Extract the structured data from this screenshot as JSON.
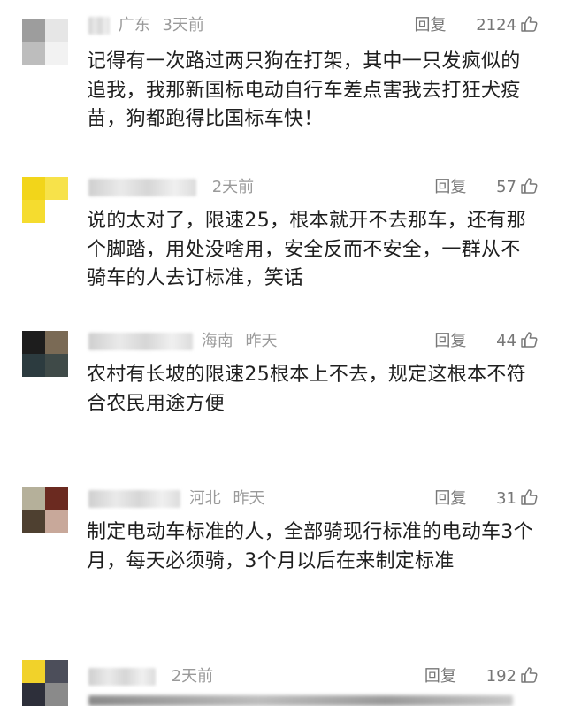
{
  "comments": [
    {
      "region": "广东",
      "time": "3天前",
      "reply_label": "回复",
      "likes": "2124",
      "text": "记得有一次路过两只狗在打架，其中一只发疯似的追我，我那新国标电动自行车差点害我去打狂犬疫苗，狗都跑得比国标车快！",
      "avatar_colors": [
        "#9d9d9d",
        "#e6e6e6",
        "#bdbdbd",
        "#f2f2f2"
      ]
    },
    {
      "region": "",
      "time": "2天前",
      "reply_label": "回复",
      "likes": "57",
      "text": "说的太对了，限速25，根本就开不去那车，还有那个脚踏，用处没啥用，安全反而不安全，一群从不骑车的人去订标准，笑话",
      "avatar_colors": [
        "#f2d51a",
        "#f7e24a",
        "#f5dc2f",
        "#ffffff"
      ]
    },
    {
      "region": "海南",
      "time": "昨天",
      "reply_label": "回复",
      "likes": "44",
      "text": "农村有长坡的限速25根本上不去，规定这根本不符合农民用途方便",
      "avatar_colors": [
        "#1d1d1d",
        "#7a6a55",
        "#2c3b3f",
        "#3f4a48"
      ]
    },
    {
      "region": "河北",
      "time": "昨天",
      "reply_label": "回复",
      "likes": "31",
      "text": "制定电动车标准的人，全部骑现行标准的电动车3个月，每天必须骑，3个月以后在来制定标准",
      "avatar_colors": [
        "#b5b09a",
        "#6b2a20",
        "#4e4030",
        "#c8a89a"
      ]
    },
    {
      "region": "",
      "time": "2天前",
      "reply_label": "回复",
      "likes": "192",
      "text": "",
      "avatar_colors": [
        "#f1d22a",
        "#4c4e5a",
        "#2d2f3a",
        "#8a8a8a"
      ]
    }
  ]
}
